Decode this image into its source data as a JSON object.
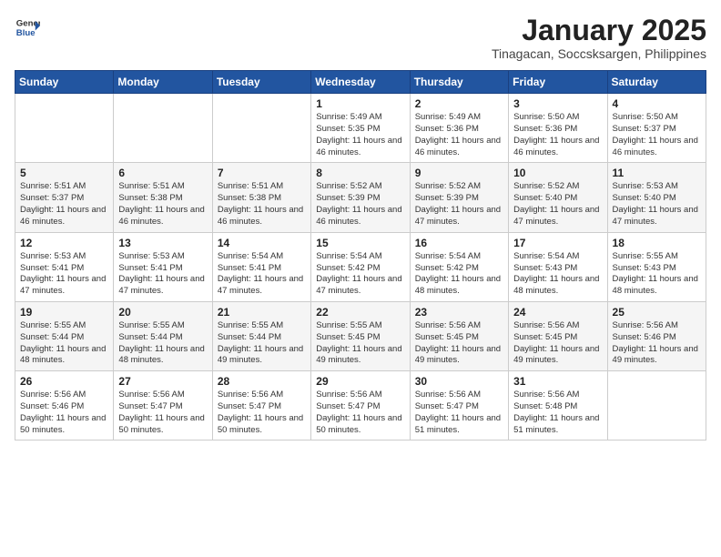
{
  "header": {
    "logo": {
      "text_general": "General",
      "text_blue": "Blue"
    },
    "title": "January 2025",
    "location": "Tinagacan, Soccsksargen, Philippines"
  },
  "weekdays": [
    "Sunday",
    "Monday",
    "Tuesday",
    "Wednesday",
    "Thursday",
    "Friday",
    "Saturday"
  ],
  "weeks": [
    [
      {
        "day": "",
        "sunrise": "",
        "sunset": "",
        "daylight": ""
      },
      {
        "day": "",
        "sunrise": "",
        "sunset": "",
        "daylight": ""
      },
      {
        "day": "",
        "sunrise": "",
        "sunset": "",
        "daylight": ""
      },
      {
        "day": "1",
        "sunrise": "Sunrise: 5:49 AM",
        "sunset": "Sunset: 5:35 PM",
        "daylight": "Daylight: 11 hours and 46 minutes."
      },
      {
        "day": "2",
        "sunrise": "Sunrise: 5:49 AM",
        "sunset": "Sunset: 5:36 PM",
        "daylight": "Daylight: 11 hours and 46 minutes."
      },
      {
        "day": "3",
        "sunrise": "Sunrise: 5:50 AM",
        "sunset": "Sunset: 5:36 PM",
        "daylight": "Daylight: 11 hours and 46 minutes."
      },
      {
        "day": "4",
        "sunrise": "Sunrise: 5:50 AM",
        "sunset": "Sunset: 5:37 PM",
        "daylight": "Daylight: 11 hours and 46 minutes."
      }
    ],
    [
      {
        "day": "5",
        "sunrise": "Sunrise: 5:51 AM",
        "sunset": "Sunset: 5:37 PM",
        "daylight": "Daylight: 11 hours and 46 minutes."
      },
      {
        "day": "6",
        "sunrise": "Sunrise: 5:51 AM",
        "sunset": "Sunset: 5:38 PM",
        "daylight": "Daylight: 11 hours and 46 minutes."
      },
      {
        "day": "7",
        "sunrise": "Sunrise: 5:51 AM",
        "sunset": "Sunset: 5:38 PM",
        "daylight": "Daylight: 11 hours and 46 minutes."
      },
      {
        "day": "8",
        "sunrise": "Sunrise: 5:52 AM",
        "sunset": "Sunset: 5:39 PM",
        "daylight": "Daylight: 11 hours and 46 minutes."
      },
      {
        "day": "9",
        "sunrise": "Sunrise: 5:52 AM",
        "sunset": "Sunset: 5:39 PM",
        "daylight": "Daylight: 11 hours and 47 minutes."
      },
      {
        "day": "10",
        "sunrise": "Sunrise: 5:52 AM",
        "sunset": "Sunset: 5:40 PM",
        "daylight": "Daylight: 11 hours and 47 minutes."
      },
      {
        "day": "11",
        "sunrise": "Sunrise: 5:53 AM",
        "sunset": "Sunset: 5:40 PM",
        "daylight": "Daylight: 11 hours and 47 minutes."
      }
    ],
    [
      {
        "day": "12",
        "sunrise": "Sunrise: 5:53 AM",
        "sunset": "Sunset: 5:41 PM",
        "daylight": "Daylight: 11 hours and 47 minutes."
      },
      {
        "day": "13",
        "sunrise": "Sunrise: 5:53 AM",
        "sunset": "Sunset: 5:41 PM",
        "daylight": "Daylight: 11 hours and 47 minutes."
      },
      {
        "day": "14",
        "sunrise": "Sunrise: 5:54 AM",
        "sunset": "Sunset: 5:41 PM",
        "daylight": "Daylight: 11 hours and 47 minutes."
      },
      {
        "day": "15",
        "sunrise": "Sunrise: 5:54 AM",
        "sunset": "Sunset: 5:42 PM",
        "daylight": "Daylight: 11 hours and 47 minutes."
      },
      {
        "day": "16",
        "sunrise": "Sunrise: 5:54 AM",
        "sunset": "Sunset: 5:42 PM",
        "daylight": "Daylight: 11 hours and 48 minutes."
      },
      {
        "day": "17",
        "sunrise": "Sunrise: 5:54 AM",
        "sunset": "Sunset: 5:43 PM",
        "daylight": "Daylight: 11 hours and 48 minutes."
      },
      {
        "day": "18",
        "sunrise": "Sunrise: 5:55 AM",
        "sunset": "Sunset: 5:43 PM",
        "daylight": "Daylight: 11 hours and 48 minutes."
      }
    ],
    [
      {
        "day": "19",
        "sunrise": "Sunrise: 5:55 AM",
        "sunset": "Sunset: 5:44 PM",
        "daylight": "Daylight: 11 hours and 48 minutes."
      },
      {
        "day": "20",
        "sunrise": "Sunrise: 5:55 AM",
        "sunset": "Sunset: 5:44 PM",
        "daylight": "Daylight: 11 hours and 48 minutes."
      },
      {
        "day": "21",
        "sunrise": "Sunrise: 5:55 AM",
        "sunset": "Sunset: 5:44 PM",
        "daylight": "Daylight: 11 hours and 49 minutes."
      },
      {
        "day": "22",
        "sunrise": "Sunrise: 5:55 AM",
        "sunset": "Sunset: 5:45 PM",
        "daylight": "Daylight: 11 hours and 49 minutes."
      },
      {
        "day": "23",
        "sunrise": "Sunrise: 5:56 AM",
        "sunset": "Sunset: 5:45 PM",
        "daylight": "Daylight: 11 hours and 49 minutes."
      },
      {
        "day": "24",
        "sunrise": "Sunrise: 5:56 AM",
        "sunset": "Sunset: 5:45 PM",
        "daylight": "Daylight: 11 hours and 49 minutes."
      },
      {
        "day": "25",
        "sunrise": "Sunrise: 5:56 AM",
        "sunset": "Sunset: 5:46 PM",
        "daylight": "Daylight: 11 hours and 49 minutes."
      }
    ],
    [
      {
        "day": "26",
        "sunrise": "Sunrise: 5:56 AM",
        "sunset": "Sunset: 5:46 PM",
        "daylight": "Daylight: 11 hours and 50 minutes."
      },
      {
        "day": "27",
        "sunrise": "Sunrise: 5:56 AM",
        "sunset": "Sunset: 5:47 PM",
        "daylight": "Daylight: 11 hours and 50 minutes."
      },
      {
        "day": "28",
        "sunrise": "Sunrise: 5:56 AM",
        "sunset": "Sunset: 5:47 PM",
        "daylight": "Daylight: 11 hours and 50 minutes."
      },
      {
        "day": "29",
        "sunrise": "Sunrise: 5:56 AM",
        "sunset": "Sunset: 5:47 PM",
        "daylight": "Daylight: 11 hours and 50 minutes."
      },
      {
        "day": "30",
        "sunrise": "Sunrise: 5:56 AM",
        "sunset": "Sunset: 5:47 PM",
        "daylight": "Daylight: 11 hours and 51 minutes."
      },
      {
        "day": "31",
        "sunrise": "Sunrise: 5:56 AM",
        "sunset": "Sunset: 5:48 PM",
        "daylight": "Daylight: 11 hours and 51 minutes."
      },
      {
        "day": "",
        "sunrise": "",
        "sunset": "",
        "daylight": ""
      }
    ]
  ]
}
